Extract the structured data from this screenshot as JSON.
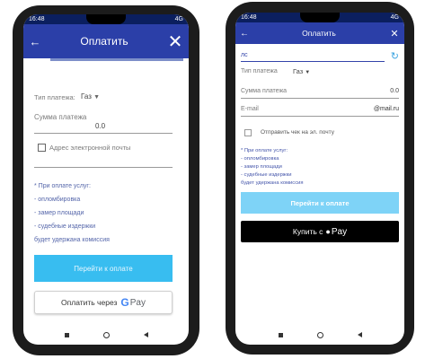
{
  "left": {
    "header": {
      "title": "Оплатить"
    },
    "payment_type": {
      "label": "Тип платежа:",
      "value": "Газ"
    },
    "amount": {
      "label": "Сумма платежа",
      "value": "0.0"
    },
    "email_checkbox": {
      "label": "Адрес электронной почты"
    },
    "notice": {
      "intro": "* При оплате услуг:",
      "items": [
        "- опломбировка",
        "- замер площади",
        "- судебные издержки"
      ],
      "outro": "будет удержана комиссия"
    },
    "proceed_button": {
      "label": "Перейти к оплате"
    },
    "gpay_button": {
      "label": "Оплатить через",
      "brand": "Pay"
    }
  },
  "right": {
    "status": {
      "time": "16:48",
      "signal": "4G"
    },
    "header": {
      "title": "Оплатить"
    },
    "account": {
      "prefix": "лс"
    },
    "payment_type": {
      "label": "Тип платежа",
      "value": "Газ"
    },
    "amount": {
      "label": "Сумма платежа",
      "value": "0.0"
    },
    "email": {
      "label": "E-mail",
      "value": "@mail.ru"
    },
    "receipt_checkbox": {
      "label": "Отправить чек на эл. почту"
    },
    "notice": {
      "intro": "* При оплате услуг:",
      "items": [
        "- опломбировка",
        "- замер площади",
        "- судебные издержки"
      ],
      "outro": "будет удержана комиссия"
    },
    "proceed_button": {
      "label": "Перейти к оплате"
    },
    "applepay_button": {
      "label": "Купить с",
      "brand": "Pay"
    }
  },
  "left_status": {
    "time": "16:48",
    "signal": "4G"
  },
  "colors": {
    "header": "#2b3fa8",
    "status": "#0b1f5f",
    "proceed": "#38bdf0",
    "proceed_light": "#7ed3f7",
    "applepay": "#000000"
  }
}
